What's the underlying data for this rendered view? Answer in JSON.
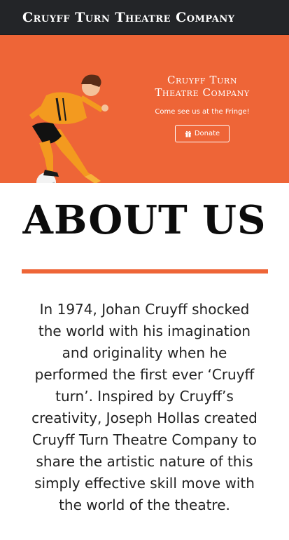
{
  "topbar": {
    "brand": "Cruyff Turn Theatre Company"
  },
  "hero": {
    "title": "Cruyff Turn\nTheatre Company",
    "subtitle": "Come see us at the Fringe!",
    "donate_label": "Donate",
    "accent_color": "#ee6537"
  },
  "about": {
    "heading": "ABOUT US",
    "body": "In 1974, Johan Cruyff shocked the world with his imagination and originality when he performed the first ever ‘Cruyff turn’. Inspired by Cruyff’s creativity, Joseph Hollas created Cruyff Turn Theatre Company to share the artistic nature of this simply effective skill move with the world of the theatre."
  }
}
